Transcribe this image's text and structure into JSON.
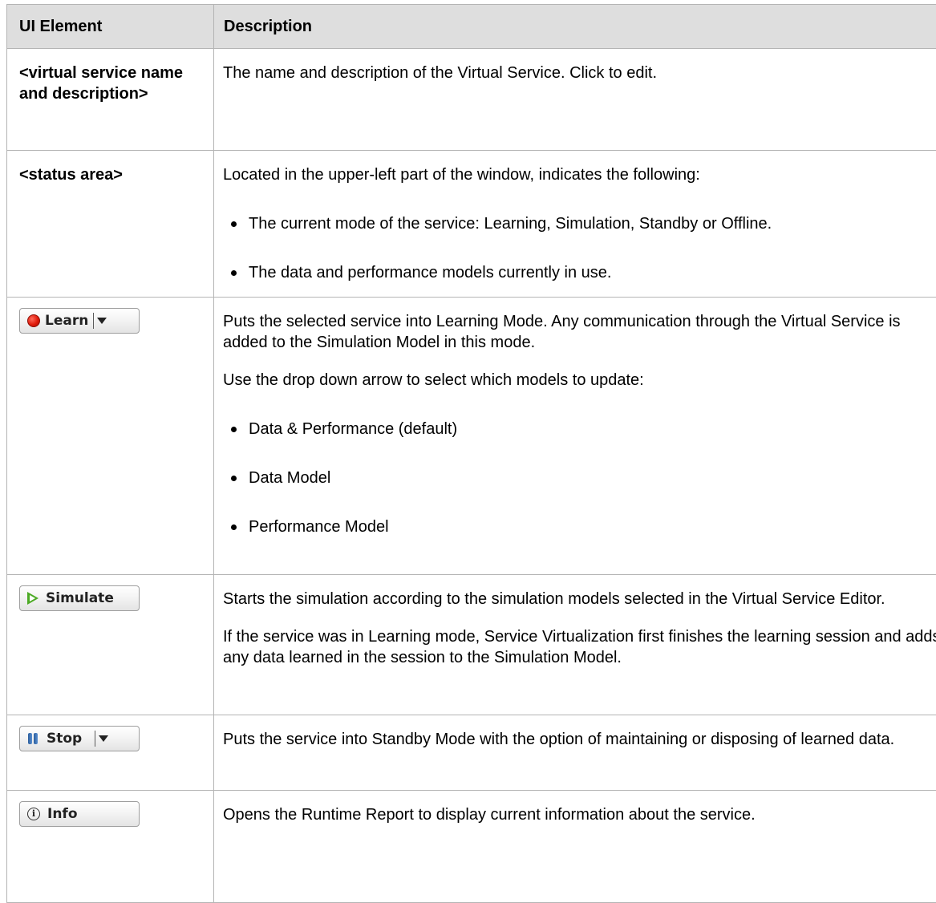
{
  "table": {
    "headers": [
      "UI Element",
      "Description"
    ],
    "rows": [
      {
        "element": "<virtual service name and description>",
        "description": [
          "The name and description of the Virtual Service. Click to edit."
        ]
      },
      {
        "element": "<status area>",
        "description": [
          "Located in the upper-left part of the window, indicates the following:"
        ],
        "bullets": [
          "The current mode of the service: Learning, Simulation, Standby or Offline.",
          "The data and performance models currently in use."
        ]
      },
      {
        "button": {
          "label": "Learn",
          "icon": "record-icon",
          "dropdown": true
        },
        "description": [
          "Puts the selected service into Learning Mode. Any communication through the Virtual Service is added to the Simulation Model in this mode.",
          "Use the drop down arrow to select which models to update:"
        ],
        "bullets": [
          "Data & Performance (default)",
          "Data Model",
          "Performance Model"
        ]
      },
      {
        "button": {
          "label": "Simulate",
          "icon": "play-icon",
          "dropdown": false
        },
        "description": [
          "Starts the simulation according to the simulation models selected in the Virtual Service Editor.",
          "If the service was in Learning mode, Service Virtualization first finishes the learning session and adds any data learned in the session to the Simulation Model."
        ]
      },
      {
        "button": {
          "label": "Stop",
          "icon": "pause-icon",
          "dropdown": true
        },
        "description": [
          "Puts the service into Standby Mode with the option of maintaining or disposing of learned data."
        ]
      },
      {
        "button": {
          "label": "Info",
          "icon": "info-icon",
          "dropdown": false
        },
        "description": [
          "Opens the Runtime Report to display current information about the service."
        ]
      }
    ]
  },
  "colors": {
    "header_bg": "#dedede",
    "border": "#b4b4b4",
    "record_red": "#e01b0b",
    "play_green": "#4caa24",
    "pause_blue": "#2a5d9c"
  }
}
